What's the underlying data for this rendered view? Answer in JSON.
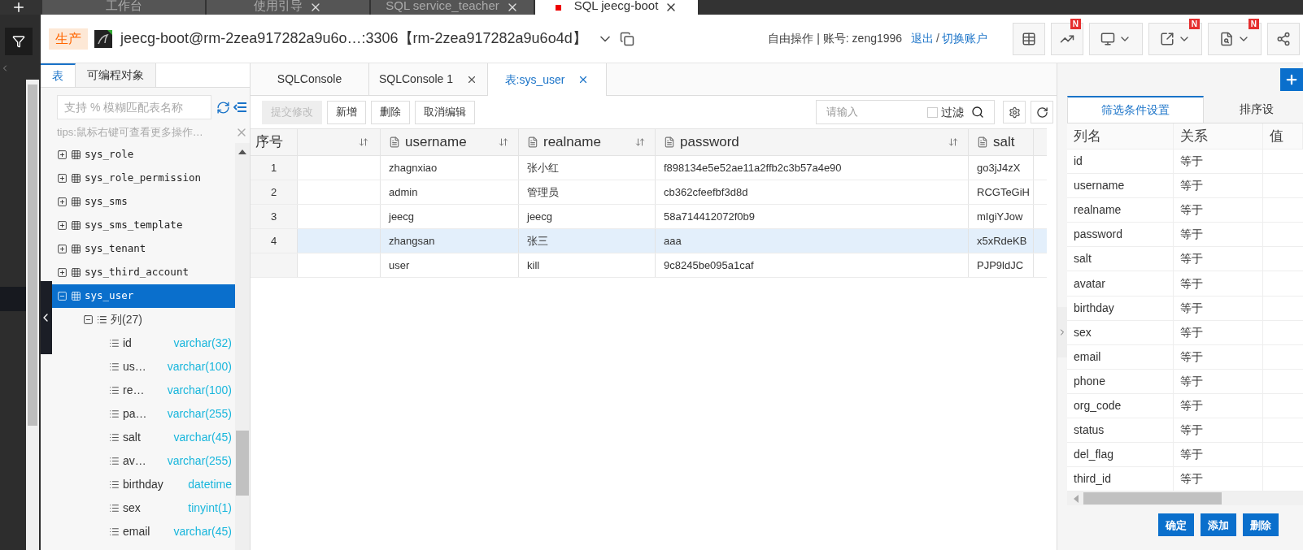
{
  "app_tabs": [
    {
      "label": "工作台",
      "selected": false,
      "closable": false,
      "marker": false
    },
    {
      "label": "使用引导",
      "selected": false,
      "closable": true,
      "marker": false
    },
    {
      "label": "SQL service_teacher",
      "selected": false,
      "closable": true,
      "marker": false
    },
    {
      "label": "SQL jeecg-boot",
      "selected": true,
      "closable": true,
      "marker": true
    }
  ],
  "connection": {
    "env": "生产",
    "name": "jeecg-boot@rm-2zea917282a9u6o…:3306【rm-2zea917282a9u6o4d】"
  },
  "account": {
    "mode": "自由操作 | 账号: zeng1996",
    "logout": "退出",
    "separator": "/",
    "switch": "切换账户"
  },
  "toolbar": [
    {
      "kind": "table",
      "dropdown": false
    },
    {
      "kind": "chart",
      "dropdown": false,
      "badge": "N"
    },
    {
      "kind": "monitor",
      "dropdown": true
    },
    {
      "kind": "export",
      "dropdown": true,
      "badge": "N"
    },
    {
      "kind": "report",
      "dropdown": true,
      "badge": "N"
    },
    {
      "kind": "share",
      "dropdown": false
    }
  ],
  "sidebar": {
    "tabs": [
      {
        "label": "表",
        "selected": true
      },
      {
        "label": "可编程对象",
        "selected": false
      }
    ],
    "search": {
      "placeholder": "支持 % 模糊匹配表名称"
    },
    "tip": "tips:鼠标右键可查看更多操作…",
    "tables": [
      {
        "name": "sys_role",
        "expanded": false,
        "selected": false
      },
      {
        "name": "sys_role_permission",
        "expanded": false,
        "selected": false
      },
      {
        "name": "sys_sms",
        "expanded": false,
        "selected": false
      },
      {
        "name": "sys_sms_template",
        "expanded": false,
        "selected": false
      },
      {
        "name": "sys_tenant",
        "expanded": false,
        "selected": false
      },
      {
        "name": "sys_third_account",
        "expanded": false,
        "selected": false
      },
      {
        "name": "sys_user",
        "expanded": true,
        "selected": true,
        "children": [
          {
            "label": "列(27)",
            "expanded": true,
            "children": [
              {
                "name": "id",
                "type": "varchar(32)"
              },
              {
                "name": "us…",
                "type": "varchar(100)"
              },
              {
                "name": "re…",
                "type": "varchar(100)"
              },
              {
                "name": "pa…",
                "type": "varchar(255)"
              },
              {
                "name": "salt",
                "type": "varchar(45)"
              },
              {
                "name": "av…",
                "type": "varchar(255)"
              },
              {
                "name": "birthday",
                "type": "datetime"
              },
              {
                "name": "sex",
                "type": "tinyint(1)"
              },
              {
                "name": "email",
                "type": "varchar(45)"
              }
            ]
          }
        ]
      }
    ]
  },
  "editor_tabs": [
    {
      "label": "SQLConsole",
      "selected": false,
      "closable": false
    },
    {
      "label": "SQLConsole 1",
      "selected": false,
      "closable": true
    },
    {
      "label": "表:sys_user",
      "selected": true,
      "closable": true
    }
  ],
  "grid_toolbar": {
    "buttons": [
      {
        "label": "提交修改",
        "disabled": true
      },
      {
        "label": "新增",
        "disabled": false
      },
      {
        "label": "删除",
        "disabled": false
      },
      {
        "label": "取消编辑",
        "disabled": false
      }
    ],
    "search": {
      "placeholder": "请输入"
    },
    "filter": {
      "label": "过滤",
      "checked": false
    }
  },
  "grid": {
    "number_header": "序号",
    "columns": [
      "username",
      "realname",
      "password",
      "salt"
    ],
    "rows": [
      {
        "number": "1",
        "selected": false,
        "cells": [
          "zhagnxiao",
          "张小红",
          "f898134e5e52ae11a2ffb2c3b57a4e90",
          "go3jJ4zX"
        ]
      },
      {
        "number": "2",
        "selected": false,
        "cells": [
          "admin",
          "管理员",
          "cb362cfeefbf3d8d",
          "RCGTeGiH"
        ]
      },
      {
        "number": "3",
        "selected": false,
        "cells": [
          "jeecg",
          "jeecg",
          "58a714412072f0b9",
          "mIgiYJow"
        ]
      },
      {
        "number": "4",
        "selected": true,
        "cells": [
          "zhangsan",
          "张三",
          "aaa",
          "x5xRdeKB"
        ]
      },
      {
        "selected": false,
        "cells": [
          "user",
          "kill",
          "9c8245be095a1caf",
          "PJP9ldJC"
        ]
      }
    ]
  },
  "filter_panel": {
    "tabs": [
      {
        "label": "筛选条件设置",
        "selected": true
      },
      {
        "label": "排序设",
        "selected": false
      }
    ],
    "columns": [
      "列名",
      "关系",
      "值"
    ],
    "rows": [
      {
        "column": "id",
        "relation": "等于"
      },
      {
        "column": "username",
        "relation": "等于"
      },
      {
        "column": "realname",
        "relation": "等于"
      },
      {
        "column": "password",
        "relation": "等于"
      },
      {
        "column": "salt",
        "relation": "等于"
      },
      {
        "column": "avatar",
        "relation": "等于"
      },
      {
        "column": "birthday",
        "relation": "等于"
      },
      {
        "column": "sex",
        "relation": "等于"
      },
      {
        "column": "email",
        "relation": "等于"
      },
      {
        "column": "phone",
        "relation": "等于"
      },
      {
        "column": "org_code",
        "relation": "等于"
      },
      {
        "column": "status",
        "relation": "等于"
      },
      {
        "column": "del_flag",
        "relation": "等于"
      },
      {
        "column": "third_id",
        "relation": "等于"
      }
    ],
    "buttons": [
      "确定",
      "添加",
      "删除"
    ]
  }
}
